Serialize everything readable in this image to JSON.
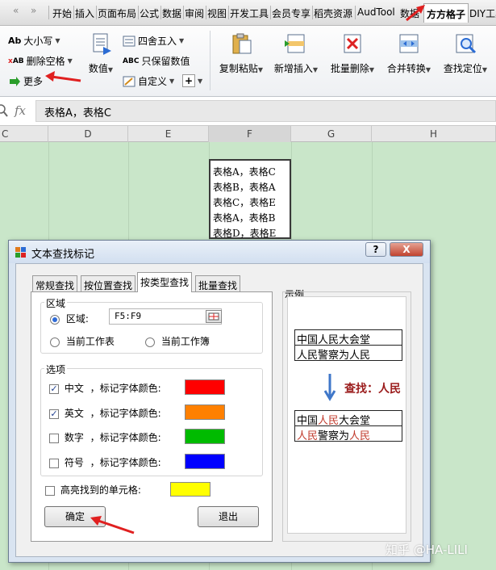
{
  "tabs": [
    "开始",
    "插入",
    "页面布局",
    "公式",
    "数据",
    "审阅",
    "视图",
    "开发工具",
    "会员专享",
    "稻壳资源",
    "AudTool",
    "数据",
    "方方格子",
    "DIY工具"
  ],
  "tabs_nav": [
    "«",
    "»"
  ],
  "ribbon": {
    "case_label": "大小写",
    "delete_space_label": "删除空格",
    "more_label": "更多",
    "numeric_label": "数值",
    "round_label": "四舍五入",
    "keep_numeric_label": "只保留数值",
    "custom_label": "自定义",
    "plus_label": "+",
    "copy_paste_label": "复制粘贴",
    "new_insert_label": "新增插入",
    "batch_delete_label": "批量删除",
    "merge_convert_label": "合并转换",
    "find_locate_label": "查找定位"
  },
  "formula_bar": {
    "fx": "fx",
    "value": "表格A，表格C"
  },
  "columns": [
    "C",
    "D",
    "E",
    "F",
    "G",
    "H"
  ],
  "cells": [
    "表格A，表格C",
    "表格B，表格A",
    "表格C，表格E",
    "表格A，表格B",
    "表格D，表格E"
  ],
  "dialog": {
    "title": "文本查找标记",
    "help": "?",
    "close": "X",
    "tabs": [
      "常规查找",
      "按位置查找",
      "按类型查找",
      "批量查找"
    ],
    "range_group": "区域",
    "range_label": "区域:",
    "range_value": "F5:F9",
    "current_sheet": "当前工作表",
    "current_book": "当前工作簿",
    "options_group": "选项",
    "options": [
      {
        "name": "中文",
        "suffix": "，标记字体颜色:",
        "checked": true,
        "color": "#ff0000"
      },
      {
        "name": "英文",
        "suffix": "，标记字体颜色:",
        "checked": true,
        "color": "#ff8000"
      },
      {
        "name": "数字",
        "suffix": "，标记字体颜色:",
        "checked": false,
        "color": "#00bb00"
      },
      {
        "name": "符号",
        "suffix": "，标记字体颜色:",
        "checked": false,
        "color": "#0000ff"
      }
    ],
    "highlight_label": "高亮找到的单元格:",
    "highlight_color": "#ffff00",
    "ok": "确定",
    "exit": "退出",
    "example_title": "示例",
    "example": {
      "before": [
        "中国人民大会堂",
        "人民警察为人民"
      ],
      "search_text": "查找：人民",
      "after_1": [
        "中国",
        "人民",
        "大会堂"
      ],
      "after_2": [
        "人民",
        "警察为",
        "人民"
      ]
    }
  },
  "watermark": "知乎 @HA-LILI",
  "colors": {
    "sheet_bg": "#c9e6c9",
    "accent_red": "#e02020",
    "dialog_frame": "#d9e4f1"
  }
}
